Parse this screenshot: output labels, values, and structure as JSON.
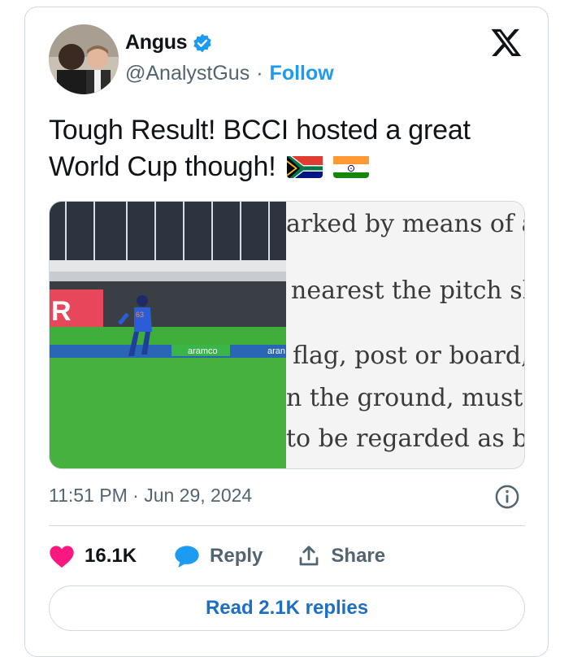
{
  "author": {
    "name": "Angus",
    "handle": "@AnalystGus",
    "separator": "·",
    "follow_label": "Follow"
  },
  "tweet": {
    "text_line1": "Tough Result! BCCI hosted a great",
    "text_line2": "World Cup though!",
    "flags": [
      "south-africa-flag",
      "india-flag"
    ]
  },
  "media": {
    "video_board_text_1": "aramco",
    "video_board_text_2": "aran",
    "player_number": "63",
    "rules_lines": [
      "arked by means of a",
      "nearest the pitch sh",
      "flag, post or board,",
      "n the ground, must",
      "to be regarded as b"
    ]
  },
  "meta": {
    "time": "11:51 PM",
    "date_sep": "·",
    "date": "Jun 29, 2024"
  },
  "actions": {
    "likes": "16.1K",
    "reply_label": "Reply",
    "share_label": "Share"
  },
  "replies_button": "Read 2.1K replies",
  "colors": {
    "accent": "#1d9bf0",
    "like": "#f91880",
    "text": "#0f1419",
    "muted": "#536471",
    "border": "#cfd9de"
  },
  "icons": [
    "verified-badge-icon",
    "x-logo-icon",
    "info-icon",
    "heart-icon",
    "reply-bubble-icon",
    "share-icon"
  ]
}
